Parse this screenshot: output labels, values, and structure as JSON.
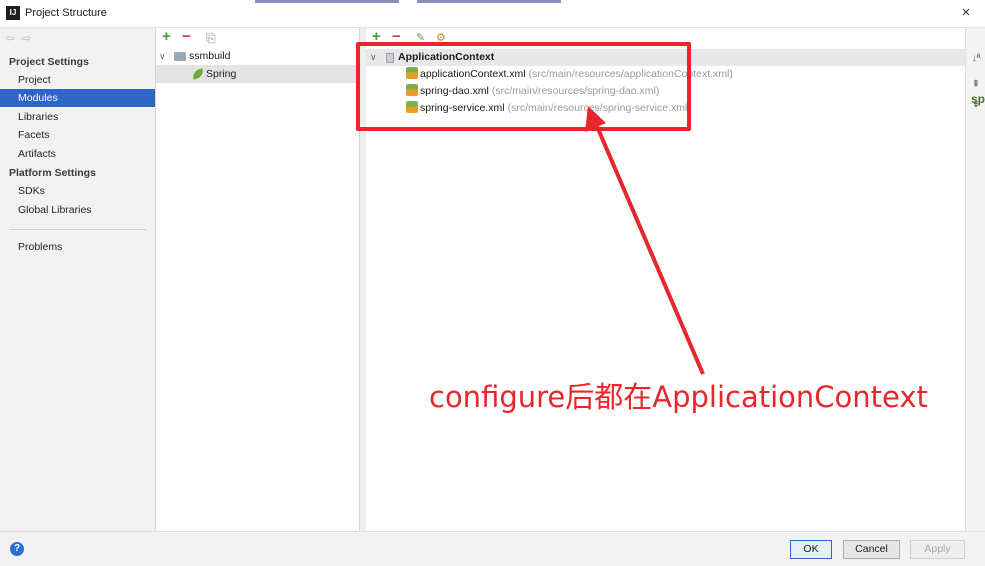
{
  "window": {
    "title": "Project Structure",
    "close_glyph": "×"
  },
  "sidebar": {
    "nav_back": "⇦",
    "nav_forward": "⇨",
    "project_settings_header": "Project Settings",
    "items_project": [
      "Project",
      "Modules",
      "Libraries",
      "Facets",
      "Artifacts"
    ],
    "platform_settings_header": "Platform Settings",
    "items_platform": [
      "SDKs",
      "Global Libraries"
    ],
    "problems": "Problems",
    "selected": "Modules"
  },
  "modules": {
    "toolbar": {
      "add": "+",
      "remove": "−",
      "copy": "⎘"
    },
    "tree": [
      {
        "label": "ssmbuild",
        "icon": "module-folder-icon"
      },
      {
        "label": "Spring",
        "icon": "spring-leaf-icon"
      }
    ]
  },
  "context": {
    "toolbar": {
      "add": "+",
      "remove": "−",
      "edit": "✎",
      "config": "⚙"
    },
    "group_label": "ApplicationContext",
    "files": [
      {
        "name": "applicationContext.xml",
        "path": "(src/main/resources/applicationContext.xml)"
      },
      {
        "name": "spring-dao.xml",
        "path": "(src/main/resources/spring-dao.xml)"
      },
      {
        "name": "spring-service.xml",
        "path": "(src/main/resources/spring-service.xml)"
      }
    ]
  },
  "side_tools": {
    "sort": "↓ª",
    "expand": "⇞",
    "collapse": "⇟"
  },
  "ghost_right_text": "sp",
  "annotation": {
    "text": "configure后都在ApplicationContext",
    "color": "#e8262d"
  },
  "buttons": {
    "ok": "OK",
    "cancel": "Cancel",
    "apply": "Apply",
    "help": "?"
  },
  "colors": {
    "selection": "#2f65ca",
    "add": "#3c9e3c",
    "remove": "#d23b3b"
  }
}
